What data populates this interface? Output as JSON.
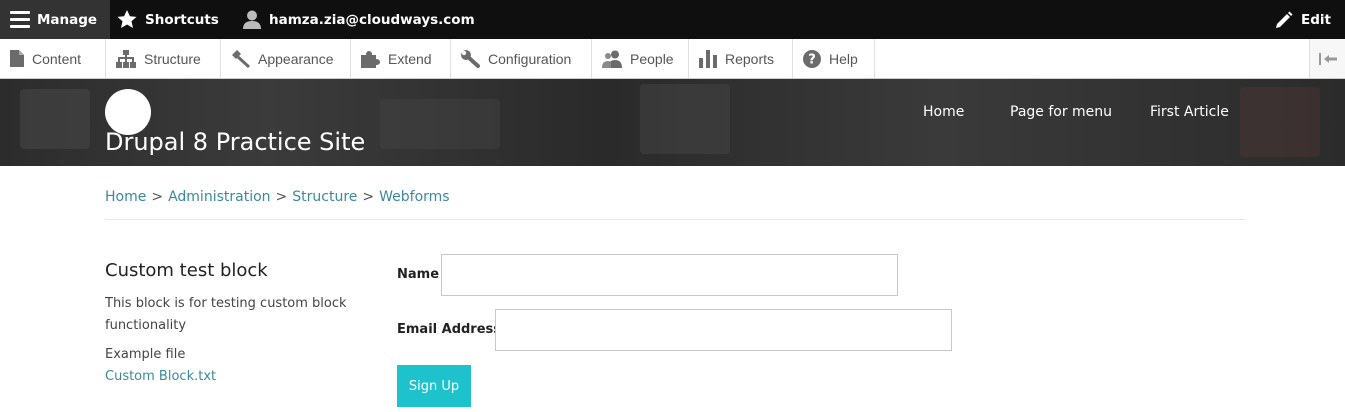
{
  "toolbar": {
    "manage_label": "Manage",
    "shortcuts_label": "Shortcuts",
    "user_label": "hamza.zia@cloudways.com",
    "edit_label": "Edit"
  },
  "tray": {
    "items": [
      {
        "label": "Content",
        "icon": "file-icon"
      },
      {
        "label": "Structure",
        "icon": "sitemap-icon"
      },
      {
        "label": "Appearance",
        "icon": "paintbrush-icon"
      },
      {
        "label": "Extend",
        "icon": "puzzle-icon"
      },
      {
        "label": "Configuration",
        "icon": "wrench-icon"
      },
      {
        "label": "People",
        "icon": "people-icon"
      },
      {
        "label": "Reports",
        "icon": "bar-chart-icon"
      },
      {
        "label": "Help",
        "icon": "help-icon"
      }
    ],
    "toggle_icon": "collapse-tray-icon"
  },
  "header": {
    "site_name": "Drupal 8 Practice Site",
    "nav": [
      "Home",
      "Page for menu",
      "First Article"
    ]
  },
  "breadcrumb": {
    "items": [
      "Home",
      "Administration",
      "Structure",
      "Webforms"
    ],
    "separator": ">"
  },
  "sidebar_block": {
    "title": "Custom test block",
    "description": "This block is for testing custom block functionality",
    "file_label": "Example file",
    "file_link": "Custom Block.txt"
  },
  "form": {
    "name_label": "Name",
    "name_value": "",
    "email_label": "Email Address",
    "email_value": "",
    "submit_label": "Sign Up"
  },
  "colors": {
    "toolbar_bg": "#0f0f0f",
    "link": "#3a8a9a",
    "submit": "#1ec2cd"
  }
}
